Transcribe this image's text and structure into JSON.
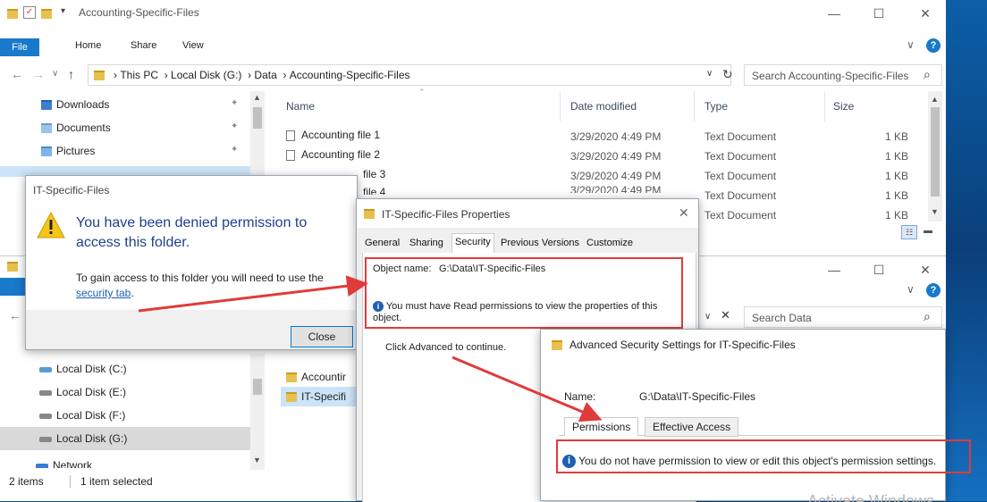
{
  "explorer": {
    "title": "Accounting-Specific-Files",
    "ribbon_tabs": [
      "File",
      "Home",
      "Share",
      "View"
    ],
    "breadcrumb": [
      "This PC",
      "Local Disk (G:)",
      "Data",
      "Accounting-Specific-Files"
    ],
    "search_placeholder": "Search Accounting-Specific-Files",
    "nav_items": [
      "Downloads",
      "Documents",
      "Pictures"
    ],
    "nav_drives": [
      "Local Disk (C:)",
      "Local Disk (E:)",
      "Local Disk (F:)",
      "Local Disk (G:)"
    ],
    "nav_network": "Network",
    "columns": [
      "Name",
      "Date modified",
      "Type",
      "Size"
    ],
    "files": [
      {
        "name": "Accounting file 1",
        "date": "3/29/2020 4:49 PM",
        "type": "Text Document",
        "size": "1 KB"
      },
      {
        "name": "Accounting file 2",
        "date": "3/29/2020 4:49 PM",
        "type": "Text Document",
        "size": "1 KB"
      },
      {
        "name": "file 3",
        "date": "3/29/2020 4:49 PM",
        "type": "Text Document",
        "size": "1 KB"
      },
      {
        "name": "file 4",
        "date": "3/29/2020 4:49 PM",
        "type": "Text Document",
        "size": "1 KB"
      },
      {
        "name": "",
        "date": "",
        "type": "Text Document",
        "size": "1 KB"
      }
    ],
    "status_count": "2 items",
    "status_selected": "1 item selected"
  },
  "second_window": {
    "search_placeholder": "Search Data",
    "folders": [
      "Accountir",
      "IT-Specifi"
    ]
  },
  "denied_dialog": {
    "title": "IT-Specific-Files",
    "heading": "You have been denied permission to access this folder.",
    "body": "To gain access to this folder you will need to use the",
    "link": "security tab",
    "link_suffix": ".",
    "close_label": "Close"
  },
  "properties": {
    "title": "IT-Specific-Files Properties",
    "tabs": [
      "General",
      "Sharing",
      "Security",
      "Previous Versions",
      "Customize"
    ],
    "object_label": "Object name:",
    "object_value": "G:\\Data\\IT-Specific-Files",
    "message": "You must have Read permissions to view the properties of this object.",
    "advanced_hint": "Click Advanced to continue."
  },
  "advanced": {
    "title": "Advanced Security Settings for IT-Specific-Files",
    "name_label": "Name:",
    "name_value": "G:\\Data\\IT-Specific-Files",
    "tabs": [
      "Permissions",
      "Effective Access"
    ],
    "message": "You do not have permission to view or edit this object's permission settings."
  },
  "watermark": "Activate Windows",
  "colors": {
    "accent": "#1979ca",
    "annotation_red": "#e03b3b",
    "link": "#1a5fb4"
  }
}
